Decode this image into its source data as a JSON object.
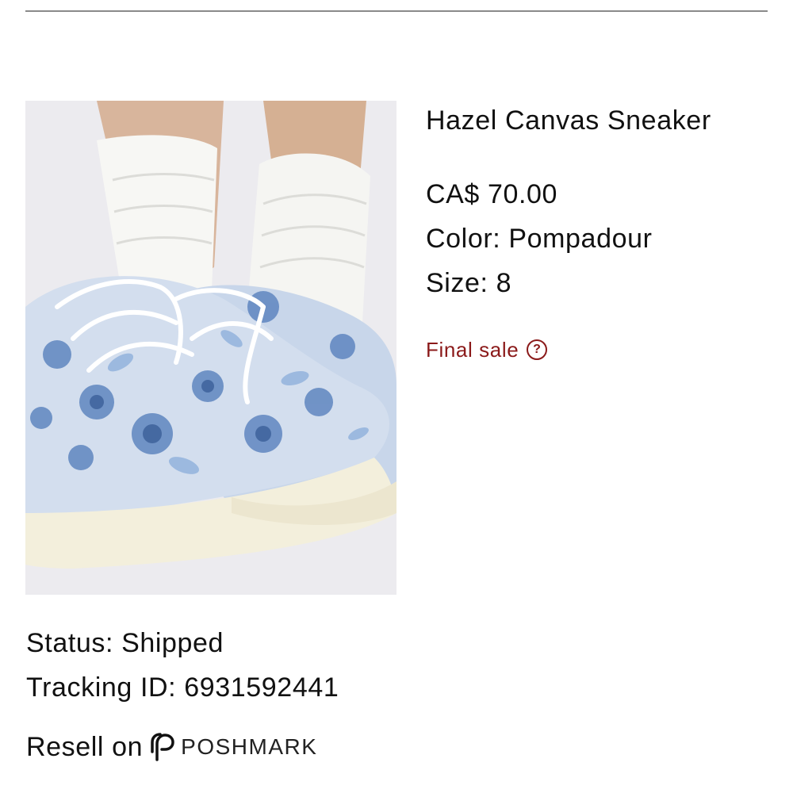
{
  "product": {
    "title": "Hazel Canvas Sneaker",
    "price": "CA$ 70.00",
    "color_line": "Color: Pompadour",
    "size_line": "Size: 8",
    "final_sale_label": "Final sale",
    "final_sale_color": "#8b1a1a",
    "help_icon": "?"
  },
  "order": {
    "status_line": "Status: Shipped",
    "tracking_line": "Tracking ID: 6931592441"
  },
  "resell": {
    "label": "Resell on",
    "brand": "POSHMARK"
  }
}
